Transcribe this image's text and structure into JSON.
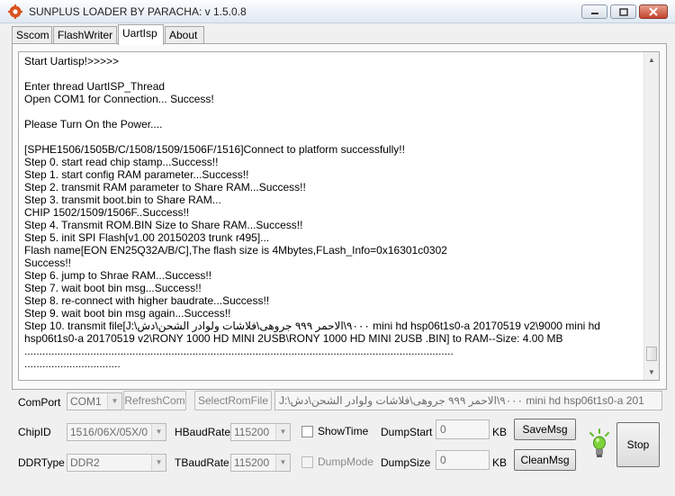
{
  "window": {
    "title": "SUNPLUS LOADER BY PARACHA: v 1.5.0.8",
    "colors": {
      "title_gradient_top": "#fcfdfe",
      "close_button": "#c4432b",
      "bulb_green": "#5fbf2a"
    }
  },
  "tabs": [
    {
      "label": "Sscom",
      "active": false
    },
    {
      "label": "FlashWriter",
      "active": false
    },
    {
      "label": "UartIsp",
      "active": true
    },
    {
      "label": "About",
      "active": false
    }
  ],
  "log": {
    "lines": [
      "Start Uartisp!>>>>>",
      "",
      "Enter thread UartISP_Thread",
      "Open COM1 for Connection... Success!",
      "",
      "Please Turn On the Power....",
      "",
      "[SPHE1506/1505B/C/1508/1509/1506F/1516]Connect to platform successfully!!",
      "Step 0. start read chip stamp...Success!!",
      "Step 1. start config RAM parameter...Success!!",
      "Step 2. transmit RAM parameter to Share RAM...Success!!",
      "Step 3. transmit boot.bin to Share RAM...",
      "CHIP 1502/1509/1506F..Success!!",
      "Step 4. Transmit ROM.BIN Size to Share RAM...Success!!",
      "Step 5. init SPI Flash[v1.00 20150203 trunk r495]...",
      "Flash name[EON EN25Q32A/B/C],The flash size is 4Mbytes,FLash_Info=0x16301c0302",
      "Success!!",
      "Step 6. jump to Shrae RAM...Success!!",
      "Step 7. wait boot bin msg...Success!!",
      "Step 8. re-connect with higher baudrate...Success!!",
      "Step 9. wait boot bin msg again...Success!!",
      "Step 10. transmit file[J:\\٩٠٠٠\\الاحمر ٩٩٩ جروهى\\فلاشات ولوادر الشحن\\دش mini hd hsp06t1s0-a 20170519 v2\\9000 mini hd",
      "hsp06t1s0-a 20170519 v2\\RONY 1000 HD MINI 2USB\\RONY 1000 HD MINI 2USB .BIN] to RAM--Size: 4.00 MB",
      "...............................................................................................................................................",
      "................................"
    ]
  },
  "controls": {
    "comport_label": "ComPort",
    "comport_value": "COM1",
    "refresh_label": "RefreshCom",
    "select_rom_label": "SelectRomFile",
    "rom_path": "J:\\٩٠٠٠\\الاحمر ٩٩٩ جروهى\\فلاشات ولوادر الشحن\\دش mini hd hsp06t1s0-a 201",
    "chipid_label": "ChipID",
    "chipid_value": "1516/06X/05X/0",
    "hbaud_label": "HBaudRate",
    "hbaud_value": "115200",
    "showtime_label": "ShowTime",
    "dumpstart_label": "DumpStart",
    "dumpstart_value": "0",
    "dumpstart_unit": "KB",
    "savemsg_label": "SaveMsg",
    "stop_label": "Stop",
    "ddrtype_label": "DDRType",
    "ddrtype_value": "DDR2",
    "tbaud_label": "TBaudRate",
    "tbaud_value": "115200",
    "dumpmode_label": "DumpMode",
    "dumpsize_label": "DumpSize",
    "dumpsize_value": "0",
    "dumpsize_unit": "KB",
    "cleanmsg_label": "CleanMsg"
  }
}
